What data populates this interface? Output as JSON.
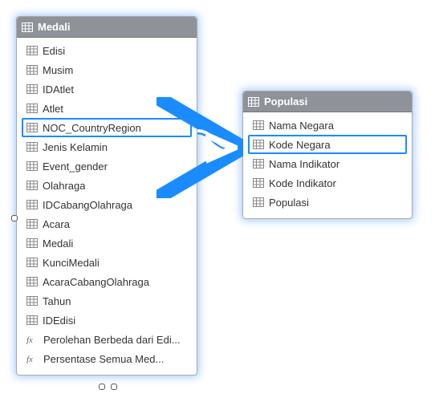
{
  "tables": {
    "medali": {
      "title": "Medali",
      "fields": [
        {
          "label": "Edisi",
          "kind": "column",
          "selected": false
        },
        {
          "label": "Musim",
          "kind": "column",
          "selected": false
        },
        {
          "label": "IDAtlet",
          "kind": "column",
          "selected": false
        },
        {
          "label": "Atlet",
          "kind": "column",
          "selected": false
        },
        {
          "label": "NOC_CountryRegion",
          "kind": "column",
          "selected": true
        },
        {
          "label": "Jenis Kelamin",
          "kind": "column",
          "selected": false
        },
        {
          "label": "Event_gender",
          "kind": "column",
          "selected": false
        },
        {
          "label": "Olahraga",
          "kind": "column",
          "selected": false
        },
        {
          "label": "IDCabangOlahraga",
          "kind": "column",
          "selected": false
        },
        {
          "label": "Acara",
          "kind": "column",
          "selected": false
        },
        {
          "label": "Medali",
          "kind": "column",
          "selected": false
        },
        {
          "label": "KunciMedali",
          "kind": "column",
          "selected": false
        },
        {
          "label": "AcaraCabangOlahraga",
          "kind": "column",
          "selected": false
        },
        {
          "label": "Tahun",
          "kind": "column",
          "selected": false
        },
        {
          "label": "IDEdisi",
          "kind": "column",
          "selected": false
        },
        {
          "label": "Perolehan Berbeda dari Edi...",
          "kind": "calc",
          "selected": false
        },
        {
          "label": "Persentase Semua Med...",
          "kind": "calc",
          "selected": false
        }
      ]
    },
    "populasi": {
      "title": "Populasi",
      "fields": [
        {
          "label": "Nama Negara",
          "kind": "column",
          "selected": false
        },
        {
          "label": "Kode Negara",
          "kind": "column",
          "selected": true
        },
        {
          "label": "Nama Indikator",
          "kind": "column",
          "selected": false
        },
        {
          "label": "Kode Indikator",
          "kind": "column",
          "selected": false
        },
        {
          "label": "Populasi",
          "kind": "column",
          "selected": false
        }
      ]
    }
  },
  "relationship": {
    "from": "tables.medali.fields.4.label",
    "to": "tables.populasi.fields.1.label"
  }
}
